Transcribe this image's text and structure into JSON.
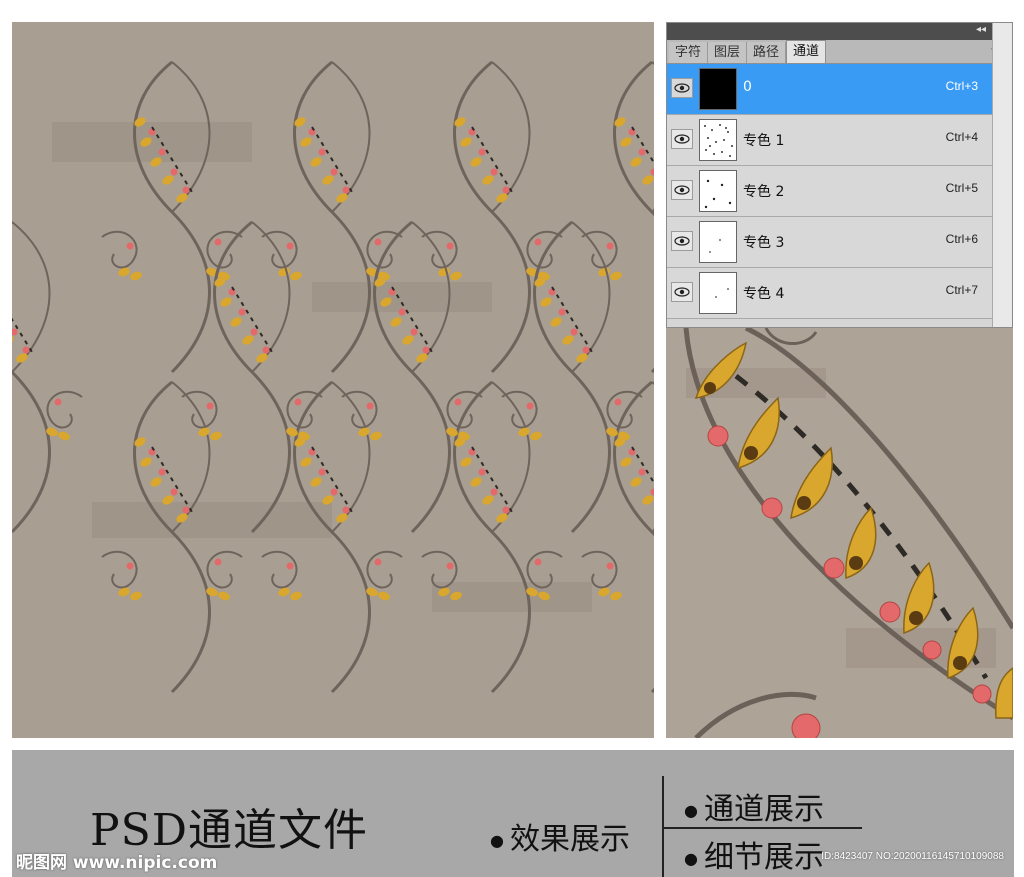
{
  "panel": {
    "tabs": [
      {
        "label": "字符"
      },
      {
        "label": "图层"
      },
      {
        "label": "路径"
      },
      {
        "label": "通道"
      }
    ],
    "active_tab": "通道",
    "channels": [
      {
        "name": "0",
        "shortcut": "Ctrl+3",
        "selected": true
      },
      {
        "name": "专色 1",
        "shortcut": "Ctrl+4",
        "selected": false
      },
      {
        "name": "专色 2",
        "shortcut": "Ctrl+5",
        "selected": false
      },
      {
        "name": "专色 3",
        "shortcut": "Ctrl+6",
        "selected": false
      },
      {
        "name": "专色 4",
        "shortcut": "Ctrl+7",
        "selected": false
      }
    ]
  },
  "banner": {
    "title": "PSD通道文件",
    "effect": "效果展示",
    "channel": "通道展示",
    "detail": "细节展示",
    "watermark": "昵图网 www.nipic.com",
    "image_id": "ID:8423407 NO:20200116145710109088"
  },
  "colors": {
    "pattern_bg": "#a89e92",
    "stem": "#6e645c",
    "leaf": "#d9a62e",
    "berry": "#e4696a",
    "selected": "#3a9bf4",
    "banner_bg": "#a8a8a8"
  }
}
